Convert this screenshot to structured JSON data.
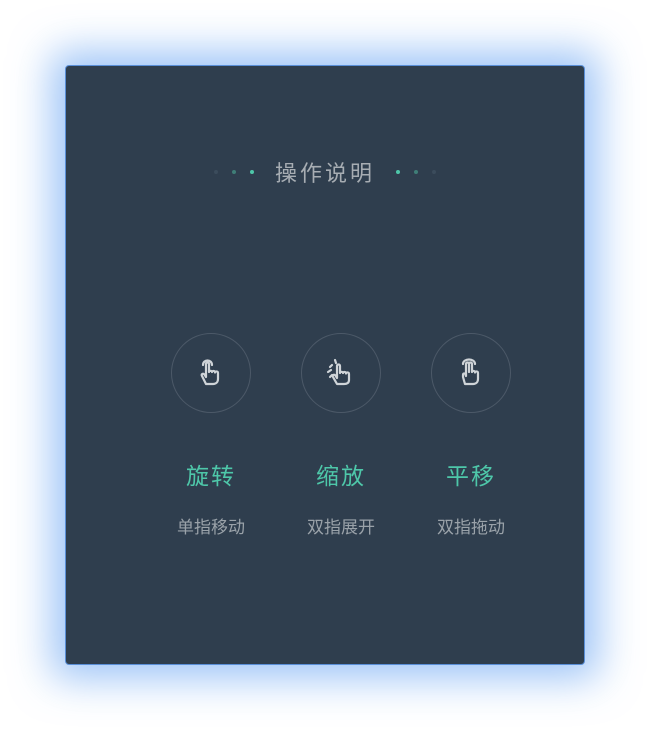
{
  "panel": {
    "title": "操作说明"
  },
  "gestures": [
    {
      "icon": "tap-hand-icon",
      "title": "旋转",
      "desc": "单指移动"
    },
    {
      "icon": "pinch-hand-icon",
      "title": "缩放",
      "desc": "双指展开"
    },
    {
      "icon": "two-finger-hand-icon",
      "title": "平移",
      "desc": "双指拖动"
    }
  ],
  "colors": {
    "panel_bg": "#2f3e4e",
    "accent": "#4ec7a9",
    "title_text": "#a7adb3",
    "desc_text": "#9aa2a9",
    "glow": "#5a9be6"
  }
}
